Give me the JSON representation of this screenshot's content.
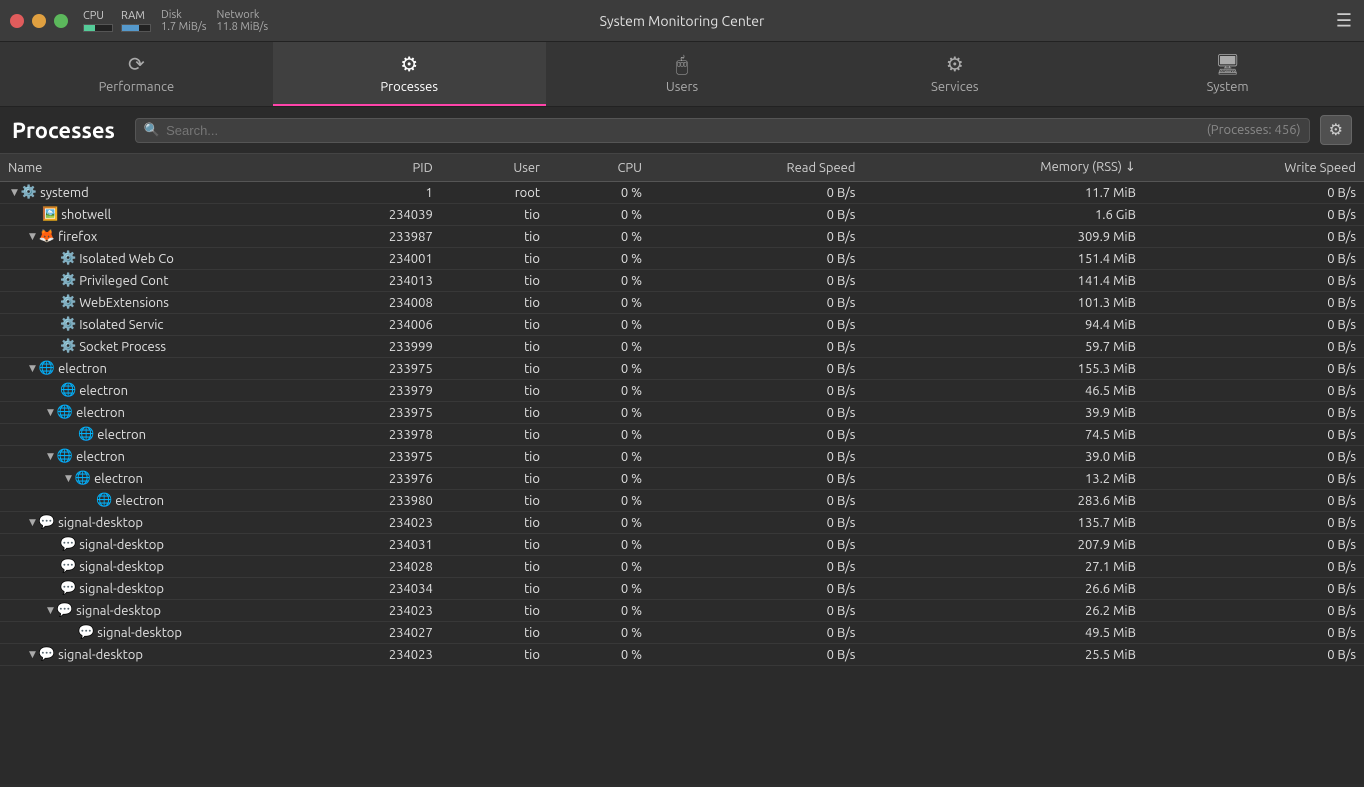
{
  "titlebar": {
    "title": "System Monitoring Center",
    "cpu_label": "CPU",
    "ram_label": "RAM",
    "disk_label": "Disk",
    "disk_rate": "1.7 MiB/s",
    "network_label": "Network",
    "network_rate": "11.8 MiB/s"
  },
  "tabs": [
    {
      "id": "performance",
      "label": "Performance",
      "icon": "📈",
      "active": false
    },
    {
      "id": "processes",
      "label": "Processes",
      "icon": "⚙️",
      "active": true
    },
    {
      "id": "users",
      "label": "Users",
      "icon": "🖱️",
      "active": false
    },
    {
      "id": "services",
      "label": "Services",
      "icon": "⚙️",
      "active": false
    },
    {
      "id": "system",
      "label": "System",
      "icon": "🖥️",
      "active": false
    }
  ],
  "processes": {
    "title": "Processes",
    "search_placeholder": "Search...",
    "count_label": "(Processes: 456)",
    "columns": [
      "Name",
      "PID",
      "User",
      "CPU",
      "Read Speed",
      "Memory (RSS)",
      "Write Speed"
    ],
    "rows": [
      {
        "name": "systemd",
        "indent": 0,
        "expand": "down",
        "icon": "⚙️",
        "pid": "1",
        "user": "root",
        "cpu": "0 %",
        "read": "0 B/s",
        "mem": "11.7 MiB",
        "write": "0 B/s"
      },
      {
        "name": "shotwell",
        "indent": 1,
        "expand": "none",
        "icon": "🖼️",
        "pid": "234039",
        "user": "tio",
        "cpu": "0 %",
        "read": "0 B/s",
        "mem": "1.6 GiB",
        "write": "0 B/s"
      },
      {
        "name": "firefox",
        "indent": 1,
        "expand": "down",
        "icon": "🦊",
        "pid": "233987",
        "user": "tio",
        "cpu": "0 %",
        "read": "0 B/s",
        "mem": "309.9 MiB",
        "write": "0 B/s"
      },
      {
        "name": "Isolated Web Co",
        "indent": 2,
        "expand": "none",
        "icon": "⚙️",
        "pid": "234001",
        "user": "tio",
        "cpu": "0 %",
        "read": "0 B/s",
        "mem": "151.4 MiB",
        "write": "0 B/s"
      },
      {
        "name": "Privileged Cont",
        "indent": 2,
        "expand": "none",
        "icon": "⚙️",
        "pid": "234013",
        "user": "tio",
        "cpu": "0 %",
        "read": "0 B/s",
        "mem": "141.4 MiB",
        "write": "0 B/s"
      },
      {
        "name": "WebExtensions",
        "indent": 2,
        "expand": "none",
        "icon": "⚙️",
        "pid": "234008",
        "user": "tio",
        "cpu": "0 %",
        "read": "0 B/s",
        "mem": "101.3 MiB",
        "write": "0 B/s"
      },
      {
        "name": "Isolated Servic",
        "indent": 2,
        "expand": "none",
        "icon": "⚙️",
        "pid": "234006",
        "user": "tio",
        "cpu": "0 %",
        "read": "0 B/s",
        "mem": "94.4 MiB",
        "write": "0 B/s"
      },
      {
        "name": "Socket Process",
        "indent": 2,
        "expand": "none",
        "icon": "⚙️",
        "pid": "233999",
        "user": "tio",
        "cpu": "0 %",
        "read": "0 B/s",
        "mem": "59.7 MiB",
        "write": "0 B/s"
      },
      {
        "name": "electron",
        "indent": 1,
        "expand": "down",
        "icon": "🌐",
        "pid": "233975",
        "user": "tio",
        "cpu": "0 %",
        "read": "0 B/s",
        "mem": "155.3 MiB",
        "write": "0 B/s"
      },
      {
        "name": "electron",
        "indent": 2,
        "expand": "none",
        "icon": "🌐",
        "pid": "233979",
        "user": "tio",
        "cpu": "0 %",
        "read": "0 B/s",
        "mem": "46.5 MiB",
        "write": "0 B/s"
      },
      {
        "name": "electron",
        "indent": 2,
        "expand": "down",
        "icon": "🌐",
        "pid": "233975",
        "user": "tio",
        "cpu": "0 %",
        "read": "0 B/s",
        "mem": "39.9 MiB",
        "write": "0 B/s"
      },
      {
        "name": "electron",
        "indent": 3,
        "expand": "none",
        "icon": "🌐",
        "pid": "233978",
        "user": "tio",
        "cpu": "0 %",
        "read": "0 B/s",
        "mem": "74.5 MiB",
        "write": "0 B/s"
      },
      {
        "name": "electron",
        "indent": 2,
        "expand": "down",
        "icon": "🌐",
        "pid": "233975",
        "user": "tio",
        "cpu": "0 %",
        "read": "0 B/s",
        "mem": "39.0 MiB",
        "write": "0 B/s"
      },
      {
        "name": "electron",
        "indent": 3,
        "expand": "down",
        "icon": "🌐",
        "pid": "233976",
        "user": "tio",
        "cpu": "0 %",
        "read": "0 B/s",
        "mem": "13.2 MiB",
        "write": "0 B/s"
      },
      {
        "name": "electron",
        "indent": 4,
        "expand": "none",
        "icon": "🌐",
        "pid": "233980",
        "user": "tio",
        "cpu": "0 %",
        "read": "0 B/s",
        "mem": "283.6 MiB",
        "write": "0 B/s"
      },
      {
        "name": "signal-desktop",
        "indent": 1,
        "expand": "down",
        "icon": "💬",
        "pid": "234023",
        "user": "tio",
        "cpu": "0 %",
        "read": "0 B/s",
        "mem": "135.7 MiB",
        "write": "0 B/s"
      },
      {
        "name": "signal-desktop",
        "indent": 2,
        "expand": "none",
        "icon": "💬",
        "pid": "234031",
        "user": "tio",
        "cpu": "0 %",
        "read": "0 B/s",
        "mem": "207.9 MiB",
        "write": "0 B/s"
      },
      {
        "name": "signal-desktop",
        "indent": 2,
        "expand": "none",
        "icon": "💬",
        "pid": "234028",
        "user": "tio",
        "cpu": "0 %",
        "read": "0 B/s",
        "mem": "27.1 MiB",
        "write": "0 B/s"
      },
      {
        "name": "signal-desktop",
        "indent": 2,
        "expand": "none",
        "icon": "💬",
        "pid": "234034",
        "user": "tio",
        "cpu": "0 %",
        "read": "0 B/s",
        "mem": "26.6 MiB",
        "write": "0 B/s"
      },
      {
        "name": "signal-desktop",
        "indent": 2,
        "expand": "down",
        "icon": "💬",
        "pid": "234023",
        "user": "tio",
        "cpu": "0 %",
        "read": "0 B/s",
        "mem": "26.2 MiB",
        "write": "0 B/s"
      },
      {
        "name": "signal-desktop",
        "indent": 3,
        "expand": "none",
        "icon": "💬",
        "pid": "234027",
        "user": "tio",
        "cpu": "0 %",
        "read": "0 B/s",
        "mem": "49.5 MiB",
        "write": "0 B/s"
      },
      {
        "name": "signal-desktop",
        "indent": 1,
        "expand": "down",
        "icon": "💬",
        "pid": "234023",
        "user": "tio",
        "cpu": "0 %",
        "read": "0 B/s",
        "mem": "25.5 MiB",
        "write": "0 B/s"
      }
    ]
  }
}
